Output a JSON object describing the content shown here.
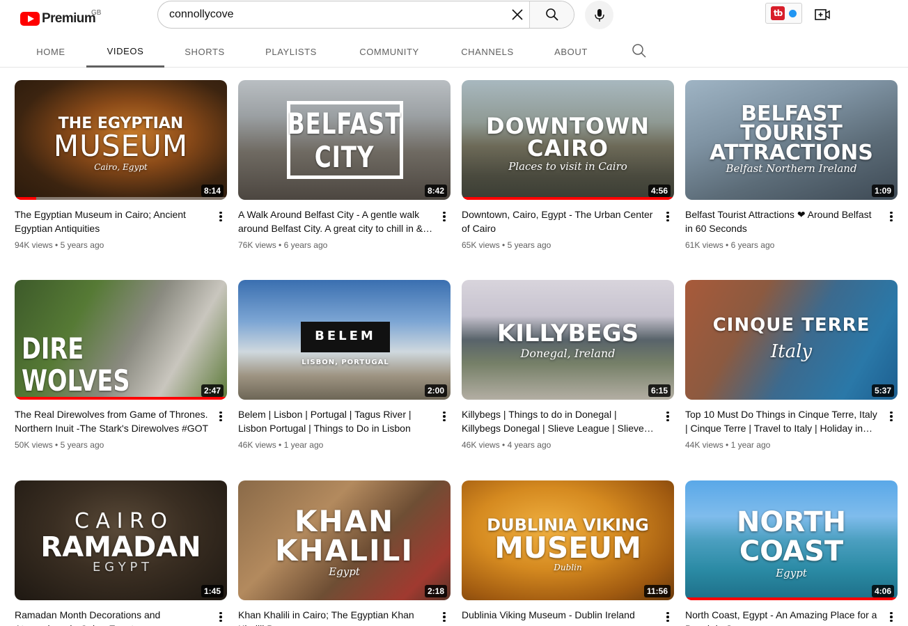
{
  "header": {
    "logo_text": "Premium",
    "region": "GB",
    "search_value": "connollycove",
    "search_icon": "search-icon",
    "clear_icon": "close-icon",
    "mic_icon": "microphone-icon",
    "extension_label": "tb",
    "create_icon": "video-add-icon"
  },
  "tabs": [
    {
      "label": "HOME",
      "active": false
    },
    {
      "label": "VIDEOS",
      "active": true
    },
    {
      "label": "SHORTS",
      "active": false
    },
    {
      "label": "PLAYLISTS",
      "active": false
    },
    {
      "label": "COMMUNITY",
      "active": false
    },
    {
      "label": "CHANNELS",
      "active": false
    },
    {
      "label": "ABOUT",
      "active": false
    }
  ],
  "videos": [
    {
      "title": "The Egyptian Museum in Cairo; Ancient Egyptian Antiquities",
      "views": "94K views",
      "age": "5 years ago",
      "duration": "8:14",
      "thumb_lines": [
        "THE EGYPTIAN",
        "MUSEUM"
      ],
      "thumb_sub": "Cairo, Egypt",
      "watched": 0.1
    },
    {
      "title": "A Walk Around Belfast City - A gentle walk around Belfast City. A great city to chill in &…",
      "views": "76K views",
      "age": "6 years ago",
      "duration": "8:42",
      "thumb_lines": [
        "BELFAST",
        "CITY"
      ],
      "thumb_sub": "",
      "watched": 0
    },
    {
      "title": "Downtown, Cairo, Egypt - The Urban Center of Cairo",
      "views": "65K views",
      "age": "5 years ago",
      "duration": "4:56",
      "thumb_lines": [
        "DOWNTOWN",
        "CAIRO"
      ],
      "thumb_sub": "Places to visit in Cairo",
      "watched": 1.0
    },
    {
      "title": "Belfast Tourist Attractions ❤ Around Belfast in 60 Seconds",
      "views": "61K views",
      "age": "6 years ago",
      "duration": "1:09",
      "thumb_lines": [
        "BELFAST",
        "TOURIST",
        "ATTRACTIONS"
      ],
      "thumb_sub": "Belfast Northern Ireland",
      "watched": 0
    },
    {
      "title": "The Real Direwolves from Game of Thrones. Northern Inuit -The Stark's Direwolves #GOT",
      "views": "50K views",
      "age": "5 years ago",
      "duration": "2:47",
      "thumb_lines": [
        "DIRE",
        "WOLVES"
      ],
      "thumb_sub": "",
      "watched": 1.0
    },
    {
      "title": "Belem | Lisbon | Portugal | Tagus River | Lisbon Portugal | Things to Do in Lisbon",
      "views": "46K views",
      "age": "1 year ago",
      "duration": "2:00",
      "thumb_lines": [
        "BELEM"
      ],
      "thumb_sub": "LISBON, PORTUGAL",
      "watched": 0
    },
    {
      "title": "Killybegs | Things to do in Donegal | Killybegs Donegal | Slieve League | Slieve…",
      "views": "46K views",
      "age": "4 years ago",
      "duration": "6:15",
      "thumb_lines": [
        "KILLYBEGS"
      ],
      "thumb_sub": "Donegal, Ireland",
      "watched": 0
    },
    {
      "title": "Top 10 Must Do Things in Cinque Terre, Italy | Cinque Terre | Travel to Italy | Holiday in…",
      "views": "44K views",
      "age": "1 year ago",
      "duration": "5:37",
      "thumb_lines": [
        "CINQUE TERRE"
      ],
      "thumb_sub": "Italy",
      "watched": 0
    },
    {
      "title": "Ramadan Month Decorations and Atmosphere in Cairo, Egypt",
      "views": "",
      "age": "",
      "duration": "1:45",
      "thumb_lines": [
        "C A I R O",
        "RAMADAN",
        "E G Y P T"
      ],
      "thumb_sub": "",
      "watched": 0
    },
    {
      "title": "Khan Khalili in Cairo; The Egyptian Khan Khalili Bazaar",
      "views": "",
      "age": "",
      "duration": "2:18",
      "thumb_lines": [
        "KHAN",
        "KHALILI"
      ],
      "thumb_sub": "Egypt",
      "watched": 0
    },
    {
      "title": "Dublinia Viking Museum - Dublin Ireland",
      "views": "",
      "age": "",
      "duration": "11:56",
      "thumb_lines": [
        "DUBLINIA VIKING",
        "MUSEUM"
      ],
      "thumb_sub": "Dublin",
      "watched": 0
    },
    {
      "title": "North Coast, Egypt - An Amazing Place for a Beach in Summer",
      "views": "",
      "age": "",
      "duration": "4:06",
      "thumb_lines": [
        "NORTH",
        "COAST"
      ],
      "thumb_sub": "Egypt",
      "watched": 1.0
    }
  ],
  "colors": {
    "accent": "#ff0000",
    "text_primary": "#0f0f0f",
    "text_secondary": "#606060"
  }
}
